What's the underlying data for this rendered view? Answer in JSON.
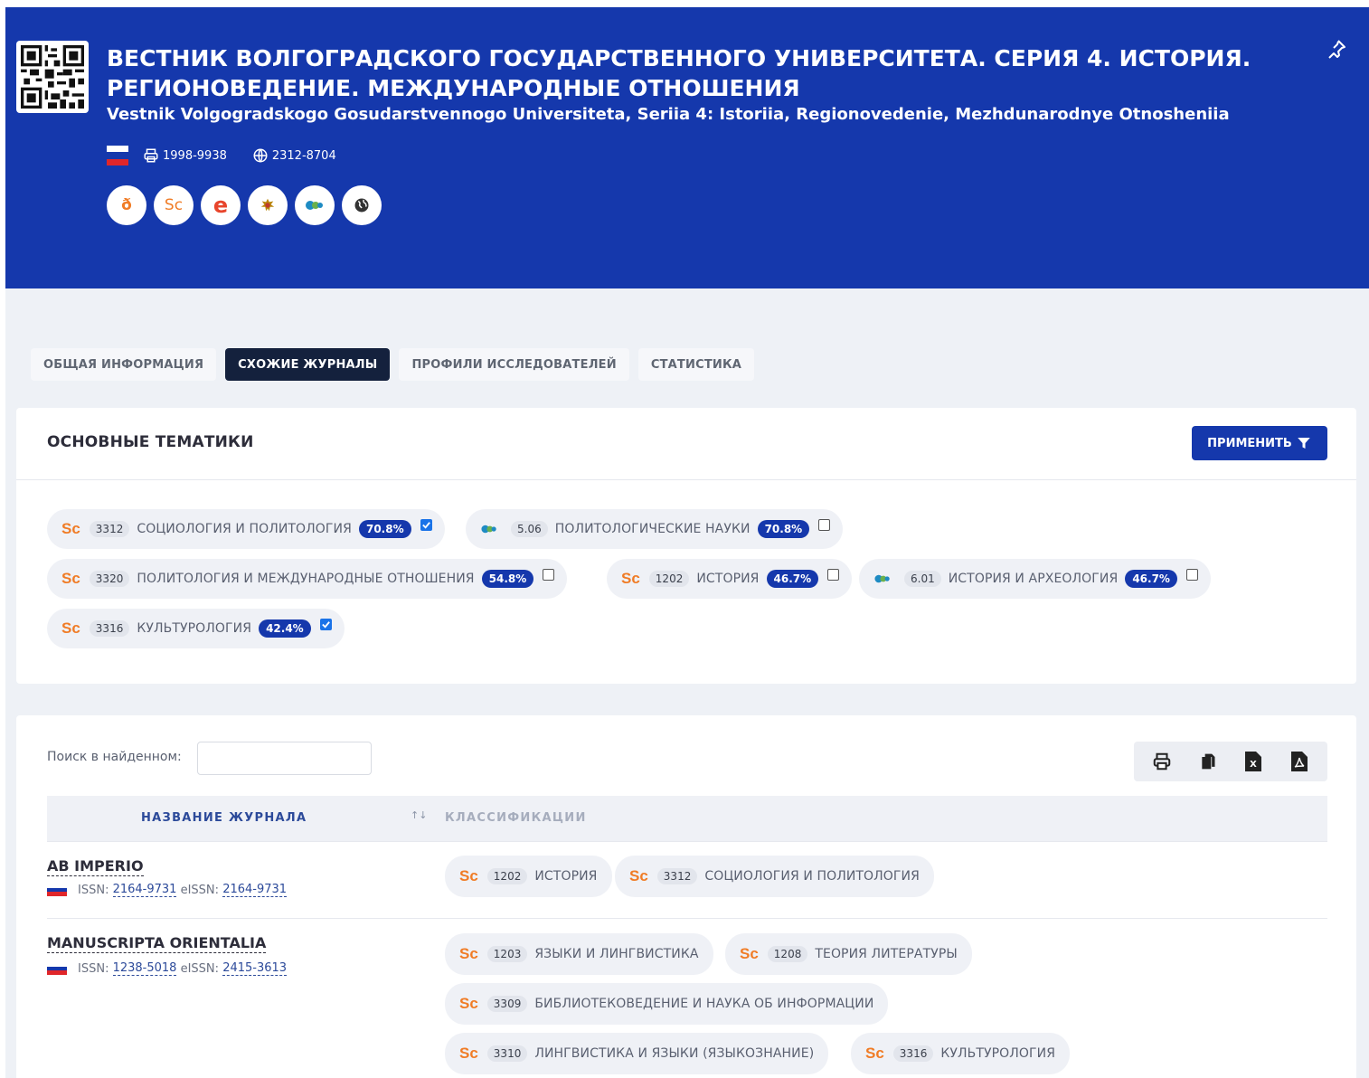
{
  "header": {
    "title": "ВЕСТНИК ВОЛГОГРАДСКОГО ГОСУДАРСТВЕННОГО УНИВЕРСИТЕТА. СЕРИЯ 4. ИСТОРИЯ. РЕГИОНОВЕДЕНИЕ. МЕЖДУНАРОДНЫЕ ОТНОШЕНИЯ",
    "subtitle": "Vestnik Volgogradskogo Gosudarstvennogo Universiteta, Seriia 4: Istoriia, Regionovedenie, Mezhdunarodnye Otnosheniia",
    "issn_print": "1998-9938",
    "issn_online": "2312-8704",
    "badges": [
      {
        "icon": "open-access-icon",
        "text": "ð",
        "color": "#f07c26"
      },
      {
        "icon": "scopus-icon",
        "text": "Sc",
        "color": "#f07c26"
      },
      {
        "icon": "elibrary-icon",
        "text": "e",
        "color": "#e8452c"
      },
      {
        "icon": "vak-emblem-icon",
        "text": "",
        "color": "#b8860b"
      },
      {
        "icon": "ras-icon",
        "text": "",
        "color": "#1e8bc3"
      },
      {
        "icon": "globe-icon",
        "text": "",
        "color": "#333333"
      }
    ]
  },
  "tabs": [
    "ОБЩАЯ ИНФОРМАЦИЯ",
    "СХОЖИЕ ЖУРНАЛЫ",
    "ПРОФИЛИ ИССЛЕДОВАТЕЛЕЙ",
    "СТАТИСТИКА"
  ],
  "active_tab": 1,
  "topics": {
    "title": "ОСНОВНЫЕ ТЕМАТИКИ",
    "apply_label": "ПРИМЕНИТЬ",
    "items": [
      {
        "src": "Sc",
        "code": "3312",
        "label": "СОЦИОЛОГИЯ И ПОЛИТОЛОГИЯ",
        "pct": "70.8%",
        "checked": true
      },
      {
        "src": "globe",
        "code": "5.06",
        "label": "ПОЛИТОЛОГИЧЕСКИЕ НАУКИ",
        "pct": "70.8%",
        "checked": false
      },
      {
        "src": "Sc",
        "code": "3320",
        "label": "ПОЛИТОЛОГИЯ И МЕЖДУНАРОДНЫЕ ОТНОШЕНИЯ",
        "pct": "54.8%",
        "checked": false
      },
      {
        "src": "Sc",
        "code": "1202",
        "label": "ИСТОРИЯ",
        "pct": "46.7%",
        "checked": false
      },
      {
        "src": "globe",
        "code": "6.01",
        "label": "ИСТОРИЯ И АРХЕОЛОГИЯ",
        "pct": "46.7%",
        "checked": false
      },
      {
        "src": "Sc",
        "code": "3316",
        "label": "КУЛЬТУРОЛОГИЯ",
        "pct": "42.4%",
        "checked": true
      }
    ]
  },
  "list": {
    "search_label": "Поиск в найденном:",
    "search_value": "",
    "col_name": "НАЗВАНИЕ ЖУРНАЛА",
    "col_class": "КЛАССИФИКАЦИИ",
    "sort_glyph": "↑↓",
    "issn_prefix": "ISSN:",
    "eissn_prefix": "eISSN:",
    "journals": [
      {
        "title": "AB IMPERIO",
        "issn": "2164-9731",
        "eissn": "2164-9731",
        "classes": [
          {
            "src": "Sc",
            "code": "1202",
            "label": "ИСТОРИЯ"
          },
          {
            "src": "Sc",
            "code": "3312",
            "label": "СОЦИОЛОГИЯ И ПОЛИТОЛОГИЯ"
          }
        ]
      },
      {
        "title": "MANUSCRIPTA ORIENTALIA",
        "issn": "1238-5018",
        "eissn": "2415-3613",
        "classes": [
          {
            "src": "Sc",
            "code": "1203",
            "label": "ЯЗЫКИ И ЛИНГВИСТИКА"
          },
          {
            "src": "Sc",
            "code": "1208",
            "label": "ТЕОРИЯ ЛИТЕРАТУРЫ"
          },
          {
            "src": "Sc",
            "code": "3309",
            "label": "БИБЛИОТЕКОВЕДЕНИЕ И НАУКА ОБ ИНФОРМАЦИИ"
          },
          {
            "src": "Sc",
            "code": "3310",
            "label": "ЛИНГВИСТИКА И ЯЗЫКИ (ЯЗЫКОЗНАНИЕ)"
          },
          {
            "src": "Sc",
            "code": "3316",
            "label": "КУЛЬТУРОЛОГИЯ"
          }
        ]
      }
    ]
  },
  "colors": {
    "brand_blue": "#1538ac",
    "scopus_orange": "#f07c26",
    "dark_tab": "#14213d"
  }
}
